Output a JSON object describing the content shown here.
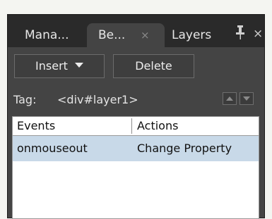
{
  "tabs": [
    {
      "label": "Mana..."
    },
    {
      "label": "Be...",
      "close": "×"
    },
    {
      "label": "Layers"
    }
  ],
  "panel": {
    "close": "×"
  },
  "toolbar": {
    "insert_label": "Insert",
    "delete_label": "Delete"
  },
  "tag": {
    "label": "Tag:",
    "value": "<div#layer1>"
  },
  "table": {
    "headers": [
      "Events",
      "Actions"
    ],
    "rows": [
      {
        "event": "onmouseout",
        "action": "Change Property"
      }
    ]
  },
  "colors": {
    "panel_bg": "#444444",
    "tab_strip_bg": "#2a2a2a",
    "selected_row": "#c8d9e8"
  },
  "icons": [
    "pin-icon",
    "close-icon",
    "dropdown-arrow-icon",
    "arrow-up-icon",
    "arrow-down-icon"
  ]
}
